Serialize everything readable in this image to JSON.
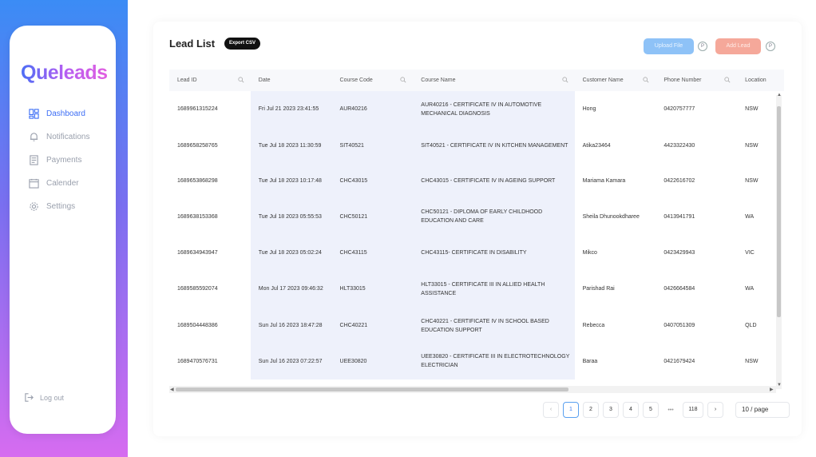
{
  "app": {
    "logo_text": "Queleads",
    "brand_gradient": [
      "#4b6ef5",
      "#e25fe0"
    ]
  },
  "sidebar": {
    "items": [
      {
        "label": "Dashboard",
        "icon": "dashboard-icon",
        "active": true
      },
      {
        "label": "Notifications",
        "icon": "bell-icon",
        "active": false
      },
      {
        "label": "Payments",
        "icon": "receipt-icon",
        "active": false
      },
      {
        "label": "Calender",
        "icon": "calendar-icon",
        "active": false
      },
      {
        "label": "Settings",
        "icon": "gear-icon",
        "active": false
      }
    ],
    "logout_label": "Log out"
  },
  "header": {
    "title": "Lead List",
    "export_label": "Export CSV",
    "upload_label": "Upload File",
    "add_label": "Add Lead",
    "help_glyph": "P"
  },
  "table": {
    "columns": [
      "Lead ID",
      "Date",
      "Course Code",
      "Course Name",
      "Customer Name",
      "Phone Number",
      "Location"
    ],
    "rows": [
      [
        "1689961315224",
        "Fri Jul 21 2023 23:41:55",
        "AUR40216",
        "AUR40216 - CERTIFICATE IV IN AUTOMOTIVE MECHANICAL DIAGNOSIS",
        "Hong",
        "0420757777",
        "NSW"
      ],
      [
        "1689658258765",
        "Tue Jul 18 2023 11:30:59",
        "SIT40521",
        "SIT40521 - CERTIFICATE IV IN KITCHEN MANAGEMENT",
        "Atika23464",
        "4423322430",
        "NSW"
      ],
      [
        "1689653868298",
        "Tue Jul 18 2023 10:17:48",
        "CHC43015",
        "CHC43015 - CERTIFICATE IV IN AGEING SUPPORT",
        "Mariama Kamara",
        "0422616702",
        "NSW"
      ],
      [
        "1689638153368",
        "Tue Jul 18 2023 05:55:53",
        "CHC50121",
        "CHC50121 - DIPLOMA OF EARLY CHILDHOOD EDUCATION AND CARE",
        "Sheila Dhunookdharee",
        "0413941791",
        "WA"
      ],
      [
        "1689634943947",
        "Tue Jul 18 2023 05:02:24",
        "CHC43115",
        "CHC43115- CERTIFICATE IN DISABILITY",
        "Mikco",
        "0423429943",
        "VIC"
      ],
      [
        "1689585592074",
        "Mon Jul 17 2023 09:46:32",
        "HLT33015",
        "HLT33015 - CERTIFICATE III IN ALLIED HEALTH ASSISTANCE",
        "Parishad Rai",
        "0426664584",
        "WA"
      ],
      [
        "1689504448386",
        "Sun Jul 16 2023 18:47:28",
        "CHC40221",
        "CHC40221 - CERTIFICATE IV IN SCHOOL BASED EDUCATION SUPPORT",
        "Rebecca",
        "0407051309",
        "QLD"
      ],
      [
        "1689470576731",
        "Sun Jul 16 2023 07:22:57",
        "UEE30820",
        "UEE30820 - CERTIFICATE III IN ELECTROTECHNOLOGY ELECTRICIAN",
        "Baraa",
        "0421679424",
        "NSW"
      ]
    ]
  },
  "pagination": {
    "prev": "‹",
    "pages": [
      "1",
      "2",
      "3",
      "4",
      "5"
    ],
    "ellipsis": "•••",
    "last": "118",
    "next": "›",
    "page_size": "10 / page",
    "current": "1"
  }
}
